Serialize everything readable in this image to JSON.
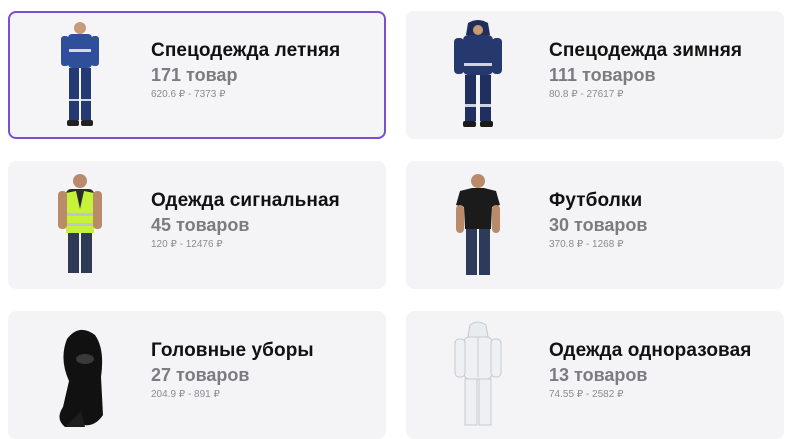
{
  "categories": [
    {
      "title": "Спецодежда летняя",
      "count": "171 товар",
      "price": "620.6 ₽ - 7373 ₽",
      "icon": "summer-workwear-icon"
    },
    {
      "title": "Спецодежда зимняя",
      "count": "111 товаров",
      "price": "80.8 ₽ - 27617 ₽",
      "icon": "winter-workwear-icon"
    },
    {
      "title": "Одежда сигнальная",
      "count": "45 товаров",
      "price": "120 ₽ - 12476 ₽",
      "icon": "signal-vest-icon"
    },
    {
      "title": "Футболки",
      "count": "30 товаров",
      "price": "370.8 ₽ - 1268 ₽",
      "icon": "tshirt-icon"
    },
    {
      "title": "Головные уборы",
      "count": "27 товаров",
      "price": "204.9 ₽ - 891 ₽",
      "icon": "balaclava-icon"
    },
    {
      "title": "Одежда одноразовая",
      "count": "13 товаров",
      "price": "74.55 ₽ - 2582 ₽",
      "icon": "disposable-suit-icon"
    }
  ],
  "colors": {
    "accent_border": "#7a4fd1",
    "card_bg": "#f4f4f6"
  }
}
